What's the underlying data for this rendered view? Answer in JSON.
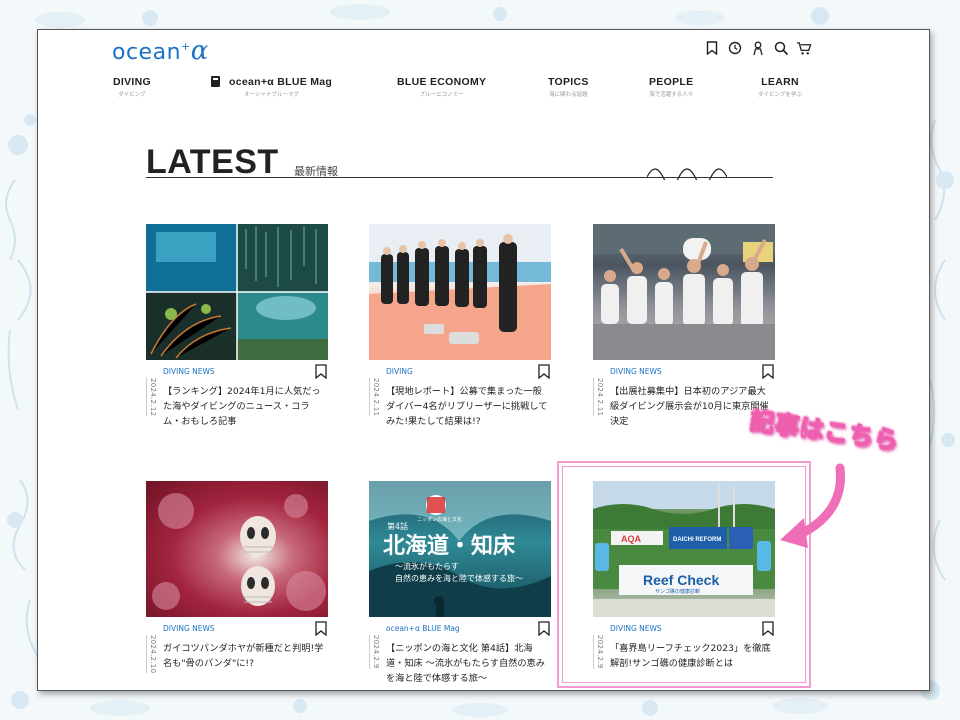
{
  "header": {
    "logo_text": "ocean",
    "logo_plus": "+",
    "logo_alpha": "α",
    "tools": [
      "bookmark-icon",
      "clock-icon",
      "user-icon",
      "search-icon",
      "cart-icon"
    ]
  },
  "nav": [
    {
      "label": "DIVING",
      "sub": "ダイビング"
    },
    {
      "label": "ocean+α BLUE Mag",
      "sub": "オーシャナブルーマグ"
    },
    {
      "label": "BLUE ECONOMY",
      "sub": "ブルーエコノミー"
    },
    {
      "label": "TOPICS",
      "sub": "海に関わる話題"
    },
    {
      "label": "PEOPLE",
      "sub": "海で活躍する人々"
    },
    {
      "label": "LEARN",
      "sub": "ダイビングを学ぶ"
    }
  ],
  "section": {
    "title": "LATEST",
    "subtitle": "最新情報"
  },
  "cards": [
    {
      "category": "DIVING NEWS",
      "date": "2024.2.12",
      "title": "【ランキング】2024年1月に人気だった海やダイビングのニュース・コラム・おもしろ記事"
    },
    {
      "category": "DIVING",
      "date": "2024.2.11",
      "title": "【現地レポート】公募で集まった一般ダイバー4名がリブリーザーに挑戦してみた!果たして結果は!?"
    },
    {
      "category": "DIVING NEWS",
      "date": "2024.2.11",
      "title": "【出展社募集中】日本初のアジア最大級ダイビング展示会が10月に東京開催決定"
    },
    {
      "category": "DIVING NEWS",
      "date": "2024.2.10",
      "title": "ガイコツパンダホヤが新種だと判明!学名も\"骨のパンダ\"に!?"
    },
    {
      "category": "ocean+α BLUE Mag",
      "date": "2024.2.9",
      "title": "【ニッポンの海と文化 第4話】北海道・知床 〜流氷がもたらす自然の恵みを海と陸で体感する旅〜",
      "thumb_text": {
        "chapter": "第4話",
        "main": "北海道・知床",
        "sub1": "〜流氷がもたらす",
        "sub2": "自然の恵みを海と陸で体感する旅〜",
        "stamp": "ニッポンの海と文化"
      }
    },
    {
      "category": "DIVING NEWS",
      "date": "2024.2.9",
      "title": "「喜界島リーフチェック2023」を徹底解剖!サンゴ礁の健康診断とは",
      "thumb_text": {
        "banner": "Reef Check",
        "banner_sub": "サンゴ礁の健康診断",
        "flag1": "AQA",
        "flag2": "DAICHI REFORM"
      }
    }
  ],
  "callout": "記事はこちら",
  "colors": {
    "accent": "#1c72c4",
    "highlight": "#f59ad0",
    "callout": "#ee5fb0"
  }
}
